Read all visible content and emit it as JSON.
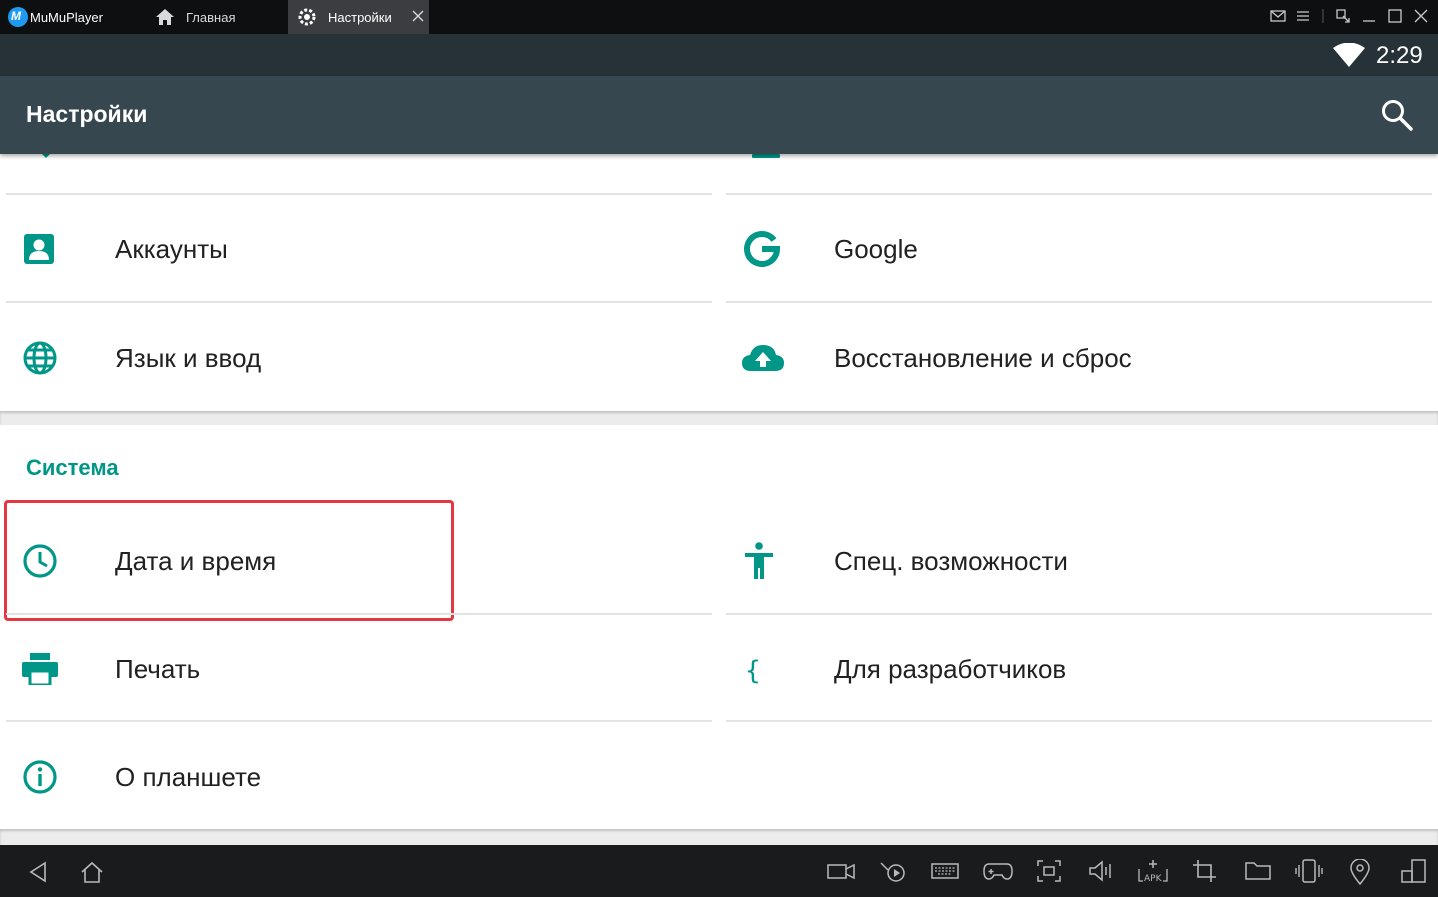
{
  "window": {
    "app_name": "MuMuPlayer",
    "tabs": [
      {
        "label": "Главная",
        "icon": "home-icon"
      },
      {
        "label": "Настройки",
        "icon": "gear-icon"
      }
    ]
  },
  "status_bar": {
    "time": "2:29"
  },
  "toolbar": {
    "title": "Настройки",
    "search_icon": "search-icon"
  },
  "settings": {
    "items_top": [
      {
        "label": "Аккаунты",
        "icon": "account-box-icon"
      },
      {
        "label": "Google",
        "icon": "google-icon"
      },
      {
        "label": "Язык и ввод",
        "icon": "globe-icon"
      },
      {
        "label": "Восстановление и сброс",
        "icon": "cloud-upload-icon"
      }
    ],
    "system_section": {
      "title": "Система",
      "items": [
        {
          "label": "Дата и время",
          "icon": "clock-icon"
        },
        {
          "label": "Спец. возможности",
          "icon": "accessibility-icon"
        },
        {
          "label": "Печать",
          "icon": "printer-icon"
        },
        {
          "label": "Для разработчиков",
          "icon": "braces-icon"
        },
        {
          "label": "О планшете",
          "icon": "info-icon"
        }
      ]
    }
  },
  "colors": {
    "accent": "#009688",
    "toolbar": "#37474f",
    "status_bar": "#263238",
    "highlight": "#e53643",
    "titlebar": "#0e0f11",
    "navbar": "#1a1b1d"
  }
}
